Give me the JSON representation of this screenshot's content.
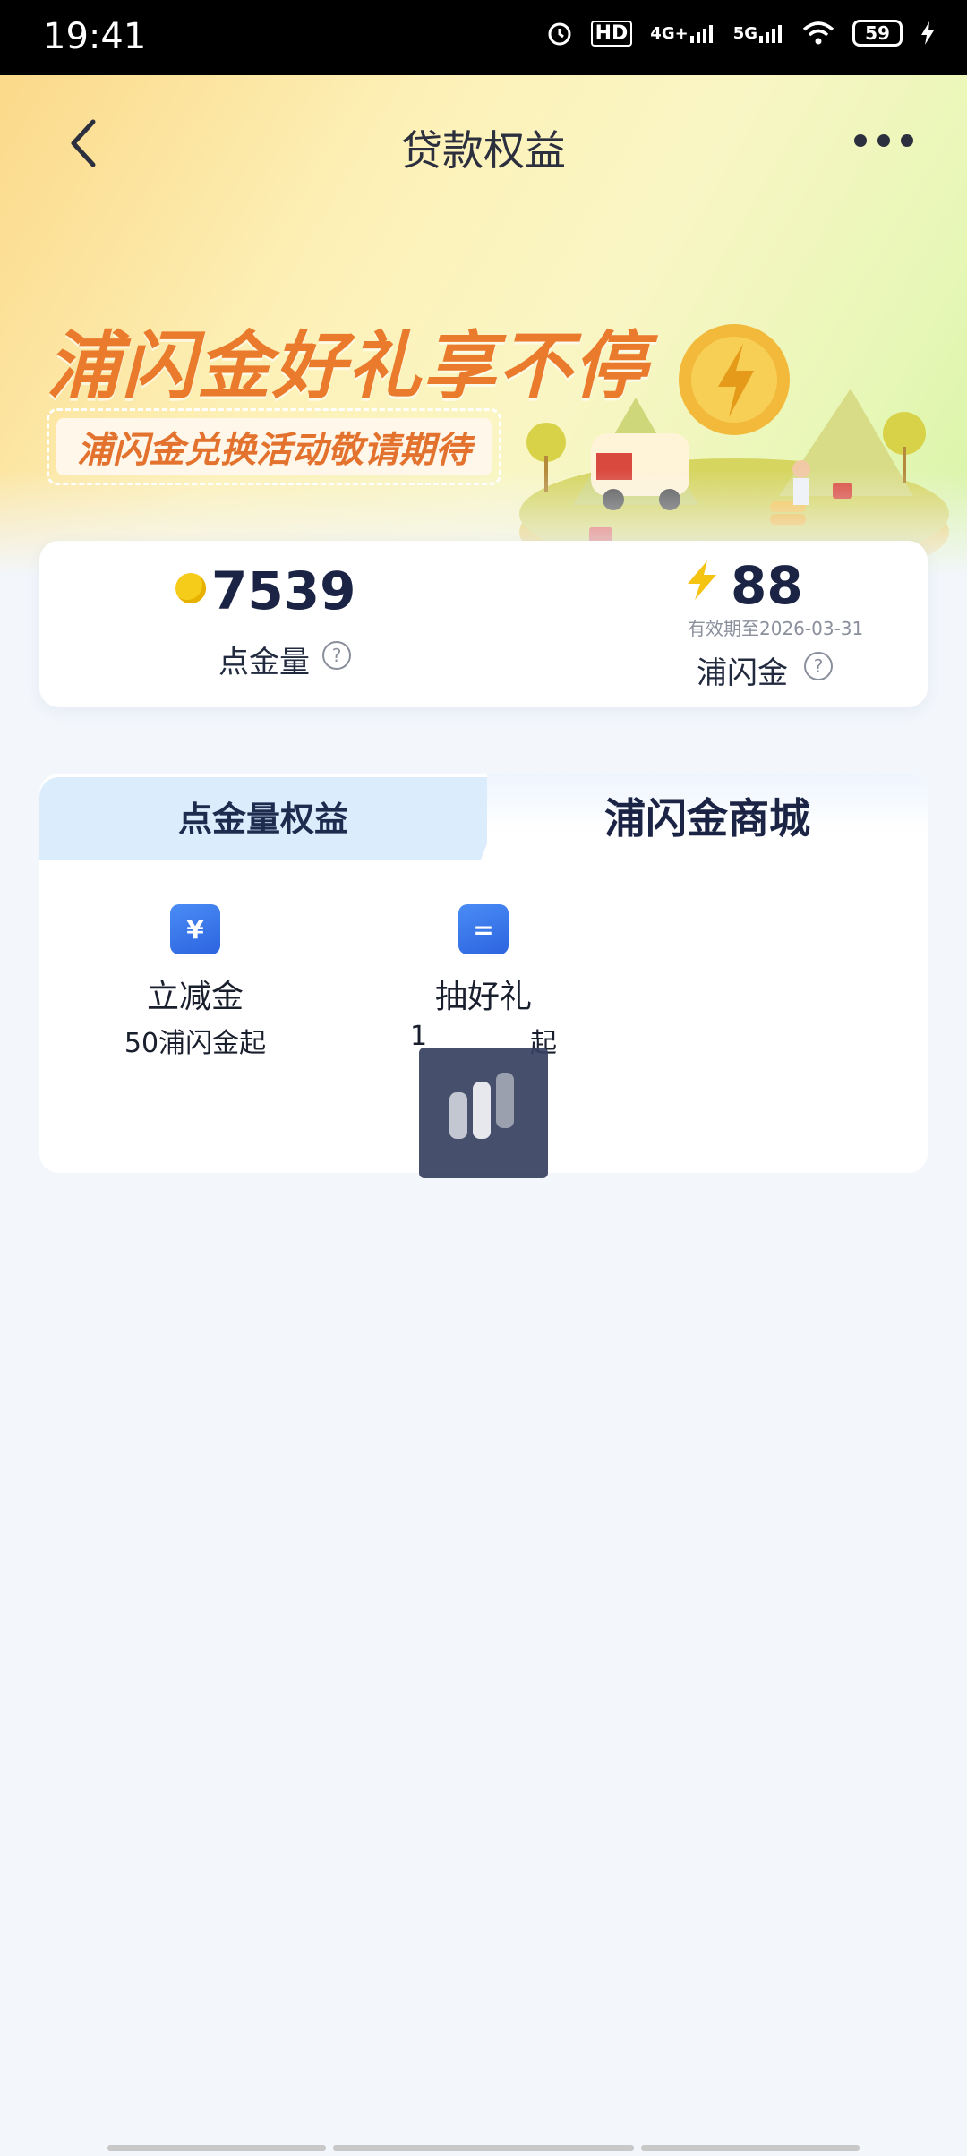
{
  "status_bar": {
    "time": "19:41",
    "network1": "HD",
    "network2": "4G+",
    "network3": "5G",
    "battery": "59"
  },
  "nav": {
    "title": "贷款权益",
    "back_icon": "chevron-left-icon",
    "more_icon": "more-dots-icon"
  },
  "hero": {
    "headline": "浦闪金好礼享不停",
    "subline": "浦闪金兑换活动敬请期待"
  },
  "points": {
    "dianjin_value": "7539",
    "dianjin_label": "点金量",
    "pushanjin_value": "88",
    "pushanjin_expire": "有效期至2026-03-31",
    "pushanjin_label": "浦闪金",
    "help_glyph": "?"
  },
  "tabs": [
    {
      "label": "点金量权益",
      "active": false
    },
    {
      "label": "浦闪金商城",
      "active": true
    }
  ],
  "items": [
    {
      "title": "立减金",
      "desc": "50浦闪金起",
      "icon": "yen-coupon-icon",
      "glyph": "¥"
    },
    {
      "title": "抽好礼",
      "desc": "1",
      "desc_tail": "起",
      "icon": "gift-ticket-icon",
      "glyph": "="
    }
  ],
  "colors": {
    "accent_orange": "#ea7a2c",
    "primary_blue": "#2c64e0",
    "tab_inactive_bg": "#dbecfc",
    "overlay": "#364060"
  }
}
